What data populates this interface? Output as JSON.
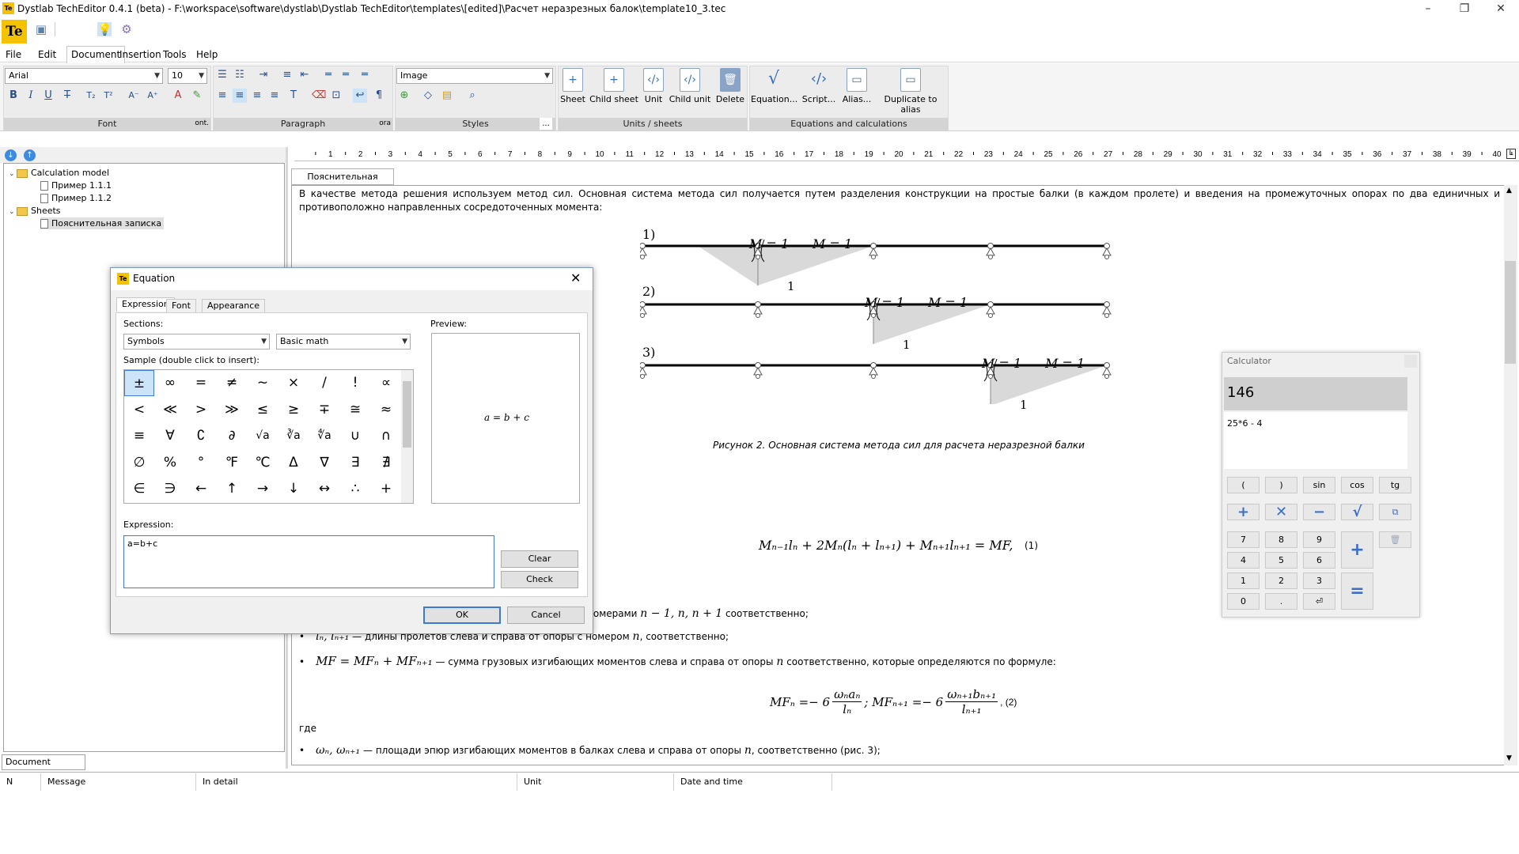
{
  "window": {
    "title": "Dystlab TechEditor 0.4.1 (beta) - F:\\workspace\\software\\dystlab\\Dystlab TechEditor\\templates\\[edited]\\Расчет неразрезных балок\\template10_3.tec",
    "logo": "Te"
  },
  "menu": [
    "File",
    "Edit",
    "Document",
    "Insertion",
    "Tools",
    "Help"
  ],
  "ribbon": {
    "font_name": "Arial",
    "font_size": "10",
    "style": "Image",
    "groups": {
      "font": "Font",
      "font_more": "ont.",
      "paragraph": "Paragraph",
      "paragraph_more": "ora",
      "styles": "Styles",
      "styles_more": "...",
      "units": "Units / sheets",
      "equations": "Equations and calculations"
    },
    "buttons": {
      "sheet": "Sheet",
      "child_sheet": "Child sheet",
      "unit": "Unit",
      "child_unit": "Child unit",
      "delete": "Delete",
      "equation": "Equation...",
      "script": "Script...",
      "alias": "Alias...",
      "duplicate": "Duplicate to alias"
    }
  },
  "tree": {
    "calc_model": "Calculation model",
    "ex1": "Пример 1.1.1",
    "ex2": "Пример 1.1.2",
    "sheets": "Sheets",
    "note": "Пояснительная записка"
  },
  "left_footer_tab": "Document structure",
  "document": {
    "tab": "Пояснительная записка",
    "intro": "В качестве метода решения используем метод сил. Основная система метода сил получается путем разделения конструкции на простые балки (в каждом пролете) и введения на промежуточных опорах по два единичных и противоположно направленных сосредоточенных момента:",
    "beam_labels": [
      "1)",
      "2)",
      "3)"
    ],
    "moment_label": "M = 1",
    "unit_label": "1",
    "caption": "Рисунок 2. Основная система метода сил для расчета неразрезной балки",
    "eq1": "Mₙ₋₁lₙ + 2Mₙ(lₙ + lₙ₊₁) + Mₙ₊₁lₙ₊₁ = MF,",
    "eq1_num": "(1)",
    "line1_tail": "номерами",
    "line1_math": "n − 1, n, n + 1",
    "line1_end": "соответственно;",
    "line2_math": "lₙ, lₙ₊₁",
    "line2_text": "— длины пролетов слева и справа от опоры с номером",
    "line2_n": "n",
    "line2_end": ", соответственно;",
    "line3_math": "MF = MFₙ + MFₙ₊₁",
    "line3_text": "— сумма грузовых изгибающих моментов слева и справа от опоры",
    "line3_n": "n",
    "line3_end": "соответственно, которые определяются по формуле:",
    "eq2_left": "MFₙ =− 6",
    "eq2_f1_num": "ωₙaₙ",
    "eq2_f1_den": "lₙ",
    "eq2_mid": "; MFₙ₊₁ =− 6",
    "eq2_f2_num": "ωₙ₊₁bₙ₊₁",
    "eq2_f2_den": "lₙ₊₁",
    "eq2_num": ", (2)",
    "where": "где",
    "line4_math": "ωₙ, ωₙ₊₁",
    "line4_text": "— площади эпюр изгибающих моментов в балках слева и справа от опоры",
    "line4_n": "n",
    "line4_end": ", соответственно (рис. 3);"
  },
  "messages": {
    "columns": [
      "N",
      "Message",
      "In detail",
      "Unit",
      "Date and time"
    ]
  },
  "dialog": {
    "title": "Equation",
    "tabs": [
      "Expression",
      "Font",
      "Appearance"
    ],
    "sections_label": "Sections:",
    "section1": "Symbols",
    "section2": "Basic math",
    "sample_label": "Sample (double click to insert):",
    "symbols": [
      [
        "±",
        "∞",
        "=",
        "≠",
        "~",
        "×",
        "/",
        "!",
        "∝"
      ],
      [
        "<",
        "≪",
        ">",
        "≫",
        "≤",
        "≥",
        "∓",
        "≅",
        "≈"
      ],
      [
        "≡",
        "∀",
        "∁",
        "∂",
        "√a",
        "∛a",
        "∜a",
        "∪",
        "∩"
      ],
      [
        "∅",
        "%",
        "°",
        "℉",
        "℃",
        "Δ",
        "∇",
        "∃",
        "∄"
      ],
      [
        "∈",
        "∋",
        "←",
        "↑",
        "→",
        "↓",
        "↔",
        "∴",
        "+"
      ]
    ],
    "preview_label": "Preview:",
    "preview": "a = b + c",
    "expression_label": "Expression:",
    "expression": "a=b+c",
    "clear": "Clear",
    "check": "Check",
    "ok": "OK",
    "cancel": "Cancel"
  },
  "calculator": {
    "title": "Calculator",
    "result": "146",
    "history": "25*6 - 4",
    "fn": [
      "(",
      ")",
      "sin",
      "cos",
      "tg"
    ],
    "digits": [
      "7",
      "8",
      "9",
      "4",
      "5",
      "6",
      "1",
      "2",
      "3",
      "0",
      "."
    ]
  }
}
